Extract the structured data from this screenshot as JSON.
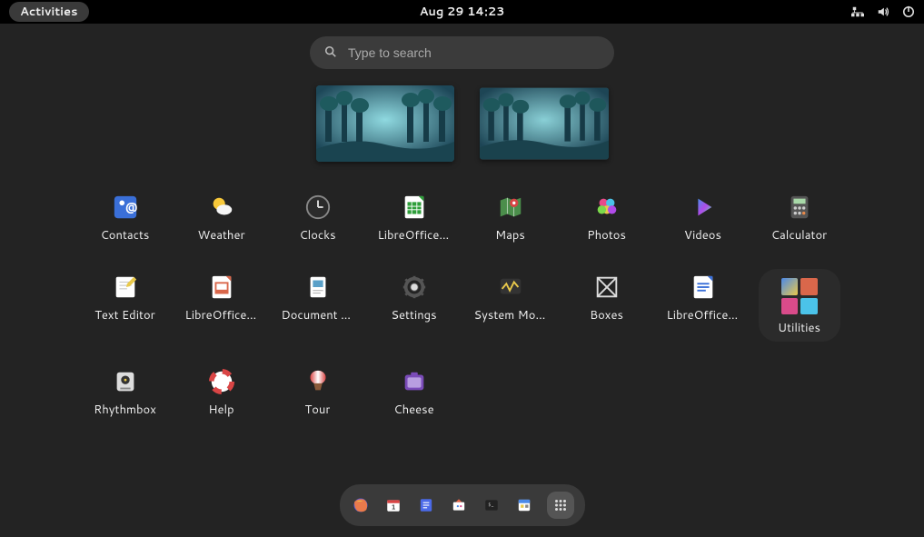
{
  "topbar": {
    "activities_label": "Activities",
    "datetime": "Aug 29  14:23"
  },
  "search": {
    "placeholder": "Type to search",
    "value": ""
  },
  "apps": [
    {
      "id": "contacts",
      "label": "Contacts"
    },
    {
      "id": "weather",
      "label": "Weather"
    },
    {
      "id": "clocks",
      "label": "Clocks"
    },
    {
      "id": "libreoffice-calc",
      "label": "LibreOffice Calc"
    },
    {
      "id": "maps",
      "label": "Maps"
    },
    {
      "id": "photos",
      "label": "Photos"
    },
    {
      "id": "videos",
      "label": "Videos"
    },
    {
      "id": "calculator",
      "label": "Calculator"
    },
    {
      "id": "text-editor",
      "label": "Text Editor"
    },
    {
      "id": "libreoffice-impress",
      "label": "LibreOffice Impress"
    },
    {
      "id": "document-viewer",
      "label": "Document Viewer"
    },
    {
      "id": "settings",
      "label": "Settings"
    },
    {
      "id": "system-monitor",
      "label": "System Monitor"
    },
    {
      "id": "boxes",
      "label": "Boxes"
    },
    {
      "id": "libreoffice-writer",
      "label": "LibreOffice Writer"
    },
    {
      "id": "utilities",
      "label": "Utilities"
    },
    {
      "id": "rhythmbox",
      "label": "Rhythmbox"
    },
    {
      "id": "help",
      "label": "Help"
    },
    {
      "id": "tour",
      "label": "Tour"
    },
    {
      "id": "cheese",
      "label": "Cheese"
    }
  ],
  "dash": [
    {
      "id": "firefox",
      "name": "Firefox"
    },
    {
      "id": "calendar",
      "name": "Calendar"
    },
    {
      "id": "todo",
      "name": "To Do"
    },
    {
      "id": "software",
      "name": "Software"
    },
    {
      "id": "terminal",
      "name": "Terminal"
    },
    {
      "id": "files",
      "name": "Files"
    },
    {
      "id": "apps",
      "name": "Show Apps",
      "active": true
    }
  ]
}
